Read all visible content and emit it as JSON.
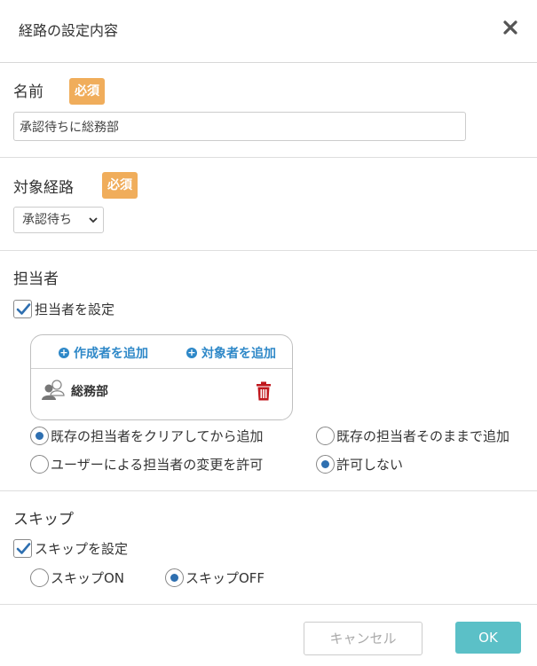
{
  "dialog": {
    "title": "経路の設定内容",
    "close_icon": "close-icon"
  },
  "name_section": {
    "label": "名前",
    "required_badge": "必須",
    "input_value": "承認待ちに総務部"
  },
  "route_section": {
    "label": "対象経路",
    "required_badge": "必須",
    "selected": "承認待ち"
  },
  "assignee_section": {
    "label": "担当者",
    "checkbox_label": "担当者を設定",
    "checkbox_checked": true,
    "add_creator": "作成者を追加",
    "add_target": "対象者を追加",
    "assignee_name": "総務部",
    "radio_clear": "既存の担当者をクリアしてから追加",
    "radio_keep": "既存の担当者そのままで追加",
    "radio_allow": "ユーザーによる担当者の変更を許可",
    "radio_disallow": "許可しない",
    "mode_selected": "clear",
    "permission_selected": "disallow"
  },
  "skip_section": {
    "label": "スキップ",
    "checkbox_label": "スキップを設定",
    "checkbox_checked": true,
    "radio_on": "スキップON",
    "radio_off": "スキップOFF",
    "selected": "off"
  },
  "footer": {
    "cancel_label": "キャンセル",
    "ok_label": "OK"
  },
  "colors": {
    "badge": "#f0ad5b",
    "link": "#2e88c8",
    "radio_dot": "#2e6fb0",
    "ok_button": "#5bc0c7",
    "trash": "#c0171d"
  }
}
